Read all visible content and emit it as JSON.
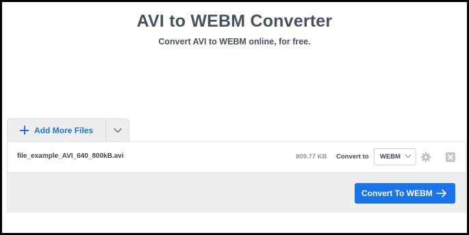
{
  "header": {
    "title": "AVI to WEBM Converter",
    "subtitle": "Convert AVI to WEBM online, for free."
  },
  "toolbar": {
    "add_files_label": "Add More Files",
    "add_files_icon": "plus-icon",
    "dropdown_icon": "chevron-down-icon"
  },
  "file": {
    "name": "file_example_AVI_640_800kB.avi",
    "size": "809.77 KB",
    "convert_to_label": "Convert to",
    "selected_format": "WEBM",
    "settings_icon": "gear-icon",
    "remove_icon": "close-icon"
  },
  "action": {
    "convert_label": "Convert To WEBM",
    "convert_icon": "arrow-right-icon"
  },
  "colors": {
    "accent": "#1a73e8",
    "title_text": "#47525d",
    "panel_gray": "#eeeeef"
  }
}
